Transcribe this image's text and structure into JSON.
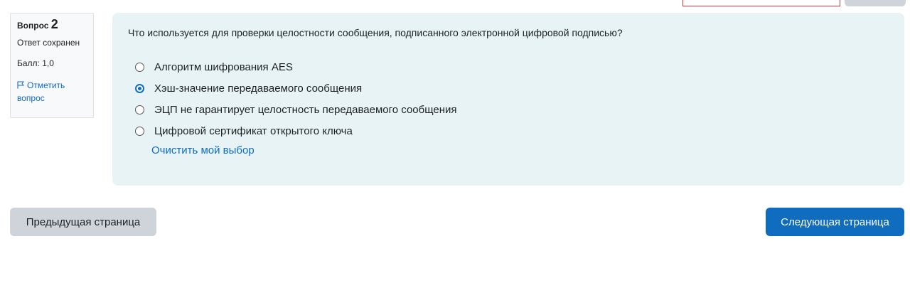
{
  "question_info": {
    "label": "Вопрос",
    "number": "2",
    "state": "Ответ сохранен",
    "grade": "Балл: 1,0",
    "flag_label_1": "Отметить",
    "flag_label_2": "вопрос"
  },
  "question": {
    "text": "Что используется для проверки целостности сообщения, подписанного электронной цифровой подписью?",
    "answers": [
      {
        "label": "Алгоритм шифрования AES",
        "checked": false
      },
      {
        "label": "Хэш-значение передаваемого сообщения",
        "checked": true
      },
      {
        "label": "ЭЦП не гарантирует целостность передаваемого сообщения",
        "checked": false
      },
      {
        "label": "Цифровой сертификат открытого ключа",
        "checked": false
      }
    ],
    "clear_label": "Очистить мой выбор"
  },
  "navigation": {
    "prev_label": "Предыдущая страница",
    "next_label": "Следующая страница"
  },
  "colors": {
    "accent": "#0f6cbf",
    "formulation_bg": "#e7f3f5",
    "secondary_button": "#ced4da"
  }
}
